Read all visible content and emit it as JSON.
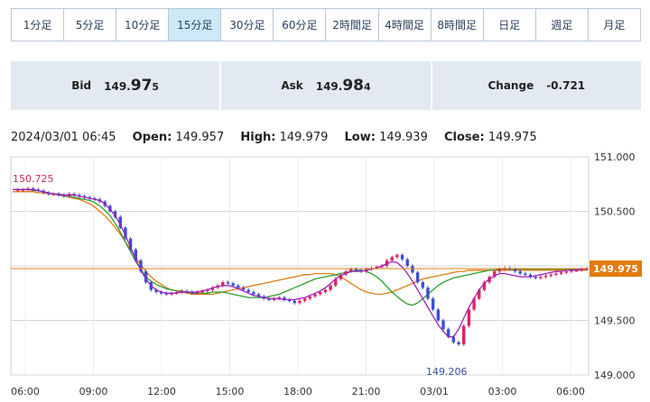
{
  "timeframes": [
    {
      "label": "1分足",
      "active": false
    },
    {
      "label": "5分足",
      "active": false
    },
    {
      "label": "10分足",
      "active": false
    },
    {
      "label": "15分足",
      "active": true
    },
    {
      "label": "30分足",
      "active": false
    },
    {
      "label": "60分足",
      "active": false
    },
    {
      "label": "2時間足",
      "active": false
    },
    {
      "label": "4時間足",
      "active": false
    },
    {
      "label": "8時間足",
      "active": false
    },
    {
      "label": "日足",
      "active": false
    },
    {
      "label": "週足",
      "active": false
    },
    {
      "label": "月足",
      "active": false
    }
  ],
  "quote": {
    "bid_label": "Bid",
    "bid_main": "149.",
    "bid_big": "97",
    "bid_small": "5",
    "ask_label": "Ask",
    "ask_main": "149.",
    "ask_big": "98",
    "ask_small": "4",
    "change_label": "Change",
    "change_value": "-0.721"
  },
  "ohlc": {
    "datetime": "2024/03/01 06:45",
    "open_label": "Open:",
    "open": "149.957",
    "high_label": "High:",
    "high": "149.979",
    "low_label": "Low:",
    "low": "149.939",
    "close_label": "Close:",
    "close": "149.975"
  },
  "chart_data": {
    "type": "candlestick",
    "y_ticks": [
      "151.000",
      "150.500",
      "150.000",
      "149.500",
      "149.000"
    ],
    "y_tick_values": [
      151.0,
      150.5,
      150.0,
      149.5,
      149.0
    ],
    "ylim": [
      149.0,
      151.0
    ],
    "x_ticks": [
      "06:00",
      "09:00",
      "12:00",
      "15:00",
      "18:00",
      "21:00",
      "03/01",
      "03:00",
      "06:00"
    ],
    "current_price": "149.975",
    "current_price_value": 149.975,
    "high_marker": "150.725",
    "low_marker": "149.206",
    "colors": {
      "up": "#e0245e",
      "down": "#3b4fd1",
      "ma_short": "#a020c0",
      "ma_mid": "#2aa02a",
      "ma_long": "#e07b10",
      "price_line": "#e07b10",
      "grid": "#d6d6d6"
    },
    "close_series": [
      150.7,
      150.7,
      150.7,
      150.71,
      150.7,
      150.69,
      150.67,
      150.66,
      150.66,
      150.65,
      150.64,
      150.66,
      150.65,
      150.64,
      150.63,
      150.62,
      150.61,
      150.59,
      150.55,
      150.5,
      150.45,
      150.35,
      150.25,
      150.15,
      150.05,
      149.95,
      149.85,
      149.78,
      149.76,
      149.75,
      149.74,
      149.75,
      149.76,
      149.77,
      149.76,
      149.75,
      149.76,
      149.77,
      149.78,
      149.8,
      149.82,
      149.85,
      149.84,
      149.82,
      149.8,
      149.78,
      149.76,
      149.74,
      149.72,
      149.7,
      149.69,
      149.7,
      149.71,
      149.69,
      149.68,
      149.66,
      149.68,
      149.7,
      149.72,
      149.74,
      149.76,
      149.78,
      149.82,
      149.88,
      149.92,
      149.95,
      149.97,
      149.96,
      149.95,
      149.97,
      149.98,
      149.99,
      150.0,
      150.05,
      150.08,
      150.1,
      150.06,
      150.0,
      149.94,
      149.85,
      149.8,
      149.7,
      149.6,
      149.5,
      149.42,
      149.35,
      149.3,
      149.28,
      149.45,
      149.6,
      149.7,
      149.78,
      149.85,
      149.9,
      149.95,
      149.97,
      149.98,
      149.97,
      149.95,
      149.93,
      149.92,
      149.9,
      149.89,
      149.9,
      149.91,
      149.92,
      149.93,
      149.94,
      149.95,
      149.96,
      149.96,
      149.97,
      149.975
    ],
    "ma_short": [
      150.7,
      150.7,
      150.7,
      150.7,
      150.7,
      150.69,
      150.68,
      150.67,
      150.66,
      150.65,
      150.65,
      150.65,
      150.65,
      150.64,
      150.63,
      150.62,
      150.61,
      150.6,
      150.57,
      150.52,
      150.46,
      150.38,
      150.28,
      150.17,
      150.06,
      149.96,
      149.88,
      149.82,
      149.78,
      149.76,
      149.75,
      149.75,
      149.75,
      149.76,
      149.76,
      149.76,
      149.76,
      149.77,
      149.78,
      149.8,
      149.81,
      149.82,
      149.82,
      149.81,
      149.79,
      149.77,
      149.75,
      149.73,
      149.72,
      149.71,
      149.7,
      149.7,
      149.7,
      149.69,
      149.69,
      149.69,
      149.7,
      149.71,
      149.73,
      149.75,
      149.77,
      149.8,
      149.84,
      149.88,
      149.91,
      149.93,
      149.95,
      149.95,
      149.95,
      149.96,
      149.97,
      149.98,
      150.0,
      150.02,
      150.04,
      150.03,
      149.99,
      149.93,
      149.86,
      149.78,
      149.7,
      149.62,
      149.54,
      149.46,
      149.4,
      149.35,
      149.35,
      149.42,
      149.52,
      149.62,
      149.7,
      149.78,
      149.84,
      149.88,
      149.91,
      149.93,
      149.93,
      149.92,
      149.91,
      149.9,
      149.9,
      149.9,
      149.91,
      149.92,
      149.93,
      149.94,
      149.95,
      149.95,
      149.96,
      149.96,
      149.96,
      149.97,
      149.97
    ],
    "ma_mid": [
      150.7,
      150.7,
      150.7,
      150.7,
      150.69,
      150.69,
      150.68,
      150.67,
      150.66,
      150.66,
      150.65,
      150.64,
      150.63,
      150.62,
      150.61,
      150.6,
      150.58,
      150.55,
      150.51,
      150.46,
      150.39,
      150.31,
      150.22,
      150.13,
      150.04,
      149.97,
      149.9,
      149.86,
      149.83,
      149.81,
      149.79,
      149.78,
      149.77,
      149.77,
      149.76,
      149.75,
      149.75,
      149.75,
      149.75,
      149.76,
      149.76,
      149.76,
      149.75,
      149.74,
      149.73,
      149.72,
      149.71,
      149.71,
      149.71,
      149.71,
      149.72,
      149.73,
      149.74,
      149.76,
      149.78,
      149.8,
      149.82,
      149.84,
      149.86,
      149.88,
      149.89,
      149.9,
      149.91,
      149.92,
      149.93,
      149.94,
      149.95,
      149.96,
      149.96,
      149.95,
      149.93,
      149.9,
      149.86,
      149.81,
      149.76,
      149.72,
      149.68,
      149.65,
      149.64,
      149.66,
      149.7,
      149.74,
      149.78,
      149.82,
      149.85,
      149.87,
      149.89,
      149.9,
      149.91,
      149.92,
      149.93,
      149.94,
      149.95,
      149.96,
      149.96,
      149.97,
      149.97,
      149.97,
      149.97,
      149.97,
      149.97,
      149.97,
      149.97,
      149.97,
      149.97,
      149.97,
      149.97,
      149.97,
      149.97,
      149.97,
      149.97,
      149.97,
      149.97
    ],
    "ma_long": [
      150.68,
      150.68,
      150.68,
      150.68,
      150.68,
      150.67,
      150.67,
      150.66,
      150.66,
      150.65,
      150.64,
      150.63,
      150.62,
      150.61,
      150.59,
      150.57,
      150.54,
      150.5,
      150.46,
      150.41,
      150.35,
      150.29,
      150.22,
      150.15,
      150.08,
      150.01,
      149.95,
      149.9,
      149.86,
      149.83,
      149.8,
      149.78,
      149.77,
      149.76,
      149.75,
      149.74,
      149.74,
      149.74,
      149.74,
      149.74,
      149.75,
      149.76,
      149.77,
      149.78,
      149.79,
      149.8,
      149.81,
      149.82,
      149.83,
      149.84,
      149.85,
      149.86,
      149.87,
      149.88,
      149.89,
      149.9,
      149.91,
      149.92,
      149.92,
      149.93,
      149.93,
      149.93,
      149.93,
      149.92,
      149.9,
      149.87,
      149.84,
      149.81,
      149.78,
      149.76,
      149.75,
      149.74,
      149.74,
      149.75,
      149.76,
      149.78,
      149.8,
      149.82,
      149.84,
      149.86,
      149.88,
      149.89,
      149.9,
      149.91,
      149.92,
      149.93,
      149.94,
      149.95,
      149.95,
      149.96,
      149.96,
      149.96,
      149.96,
      149.96,
      149.96,
      149.96,
      149.96,
      149.96,
      149.96,
      149.96,
      149.96,
      149.96,
      149.96,
      149.96,
      149.96,
      149.96,
      149.96,
      149.96,
      149.96,
      149.96,
      149.96,
      149.96,
      149.96
    ]
  }
}
